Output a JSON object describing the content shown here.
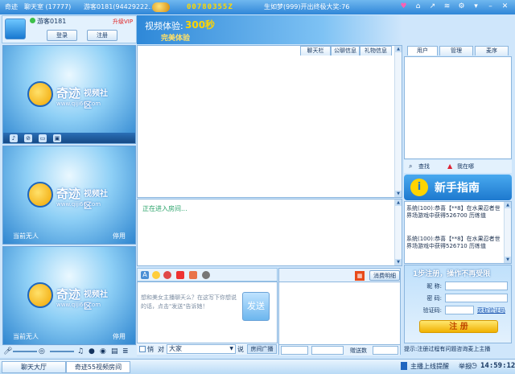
{
  "titlebar": {
    "app": "奇迹",
    "room": "聊天室 (17777)",
    "user": "游客0181(94429222...",
    "coin_value": "00780355Z",
    "news": "生如梦(999)开出终极大奖:76"
  },
  "user_panel": {
    "name": "游客0181",
    "upgrade": "升级VIP",
    "login": "登录",
    "register": "注册"
  },
  "videos": [
    {
      "brand": "奇迹",
      "tagline": "视频社区",
      "url": "www.qiji66.com",
      "status": "",
      "stop": ""
    },
    {
      "brand": "奇迹",
      "tagline": "视频社区",
      "url": "www.qiji66.com",
      "status": "当前无人",
      "stop": "停用"
    },
    {
      "brand": "奇迹",
      "tagline": "视频社区",
      "url": "www.qiji66.com",
      "status": "当前无人",
      "stop": "停用"
    }
  ],
  "timer": {
    "label": "视频体验:",
    "seconds": "300秒",
    "perfect": "完美体验"
  },
  "chat_tabs": [
    "聊天栏",
    "公聊信息",
    "礼物信息"
  ],
  "chat": {
    "entering": "正在进入房间..."
  },
  "input": {
    "hint": "想和美女主播聊天么？在这写下你想说的话，点击\"发送\"告诉她！",
    "send": "发送"
  },
  "chat_options": {
    "private": "悄",
    "to": "对",
    "target": "大家",
    "say": "说",
    "broadcast_tab": "房间广播"
  },
  "broadcast": {
    "rules": "消费明细",
    "count_label": "赠送数"
  },
  "right_tabs": [
    "用户",
    "管理",
    "麦序"
  ],
  "find": {
    "search": "查找",
    "where": "我在哪"
  },
  "guide": {
    "label": "新手指南"
  },
  "system_messages": [
    "系统(100):恭喜【**8】在水果忍者世界场游戏中获得526700 历练值",
    "系统(100):恭喜【**8】在水果忍者世界场游戏中获得526710 历练值"
  ],
  "register_panel": {
    "title": "1步注册，操作不再受限",
    "nick": "昵 称:",
    "pwd": "密 码:",
    "code": "验证码:",
    "get_code": "获取验证码",
    "button": "注 册"
  },
  "hint": "提示:注册过程有问题咨询麦上主播",
  "statusbar": {
    "tab1": "聊天大厅",
    "tab2": "奇迹55视频房间",
    "notify": "主播上线提醒",
    "report": "举报",
    "clock": "14:59:12"
  },
  "colors": {
    "accent": "#2f86d8",
    "gold": "#ffd400",
    "green": "#2aa36a"
  }
}
